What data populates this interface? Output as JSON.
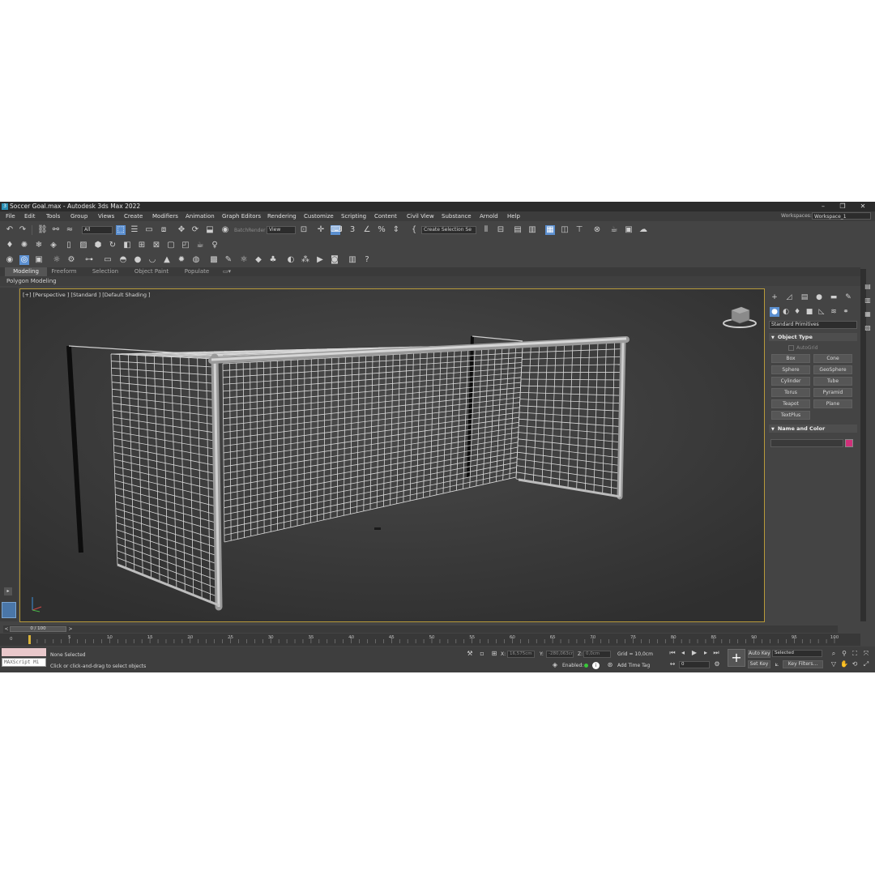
{
  "window": {
    "title": "Soccer Goal.max - Autodesk 3ds Max 2022",
    "app_icon": "3",
    "controls": [
      "–",
      "❐",
      "✕"
    ]
  },
  "menu": [
    "File",
    "Edit",
    "Tools",
    "Group",
    "Views",
    "Create",
    "Modifiers",
    "Animation",
    "Graph Editors",
    "Rendering",
    "Customize",
    "Scripting",
    "Content",
    "Civil View",
    "Substance",
    "Arnold",
    "Help"
  ],
  "workspaces": {
    "label": "Workspaces:",
    "value": "Workspace_1"
  },
  "toolbar": {
    "filter_value": "All",
    "batch_render": "BatchRender",
    "coord_value": "View",
    "selection_set": "Create Selection Se"
  },
  "ribbon": {
    "tabs": [
      "Modeling",
      "Freeform",
      "Selection",
      "Object Paint",
      "Populate"
    ],
    "active_tab": "Modeling",
    "sub": "Polygon Modeling"
  },
  "viewport": {
    "label": "[+] [Perspective ] [Standard ] [Default Shading ]"
  },
  "command_panel": {
    "category": "Standard Primitives",
    "object_type_header": "Object Type",
    "autogrid": "AutoGrid",
    "primitives": [
      "Box",
      "Cone",
      "Sphere",
      "GeoSphere",
      "Cylinder",
      "Tube",
      "Torus",
      "Pyramid",
      "Teapot",
      "Plane",
      "TextPlus"
    ],
    "name_color_header": "Name and Color",
    "object_color": "#d0307a"
  },
  "timeline": {
    "frame_display": "0 / 100",
    "ticks": [
      "0",
      "5",
      "10",
      "15",
      "20",
      "25",
      "30",
      "35",
      "40",
      "45",
      "50",
      "55",
      "60",
      "65",
      "70",
      "75",
      "80",
      "85",
      "90",
      "95",
      "100"
    ]
  },
  "status": {
    "maxscript_placeholder": "MAXScript Mi",
    "selection": "None Selected",
    "prompt": "Click or click-and-drag to select objects",
    "x_label": "X:",
    "x_value": "16,575cm",
    "y_label": "Y:",
    "y_value": "-280,063cm",
    "z_label": "Z:",
    "z_value": "0,0cm",
    "grid": "Grid = 10,0cm",
    "enabled": "Enabled:",
    "add_time_tag": "Add Time Tag",
    "auto_key": "Auto Key",
    "set_key": "Set Key",
    "key_mode": "Selected",
    "key_filters": "Key Filters...",
    "frame_value": "0"
  },
  "colors": {
    "accent": "#5b8fd0",
    "viewport_border": "#b89a3a",
    "enabled_dot": "#39c83a"
  }
}
